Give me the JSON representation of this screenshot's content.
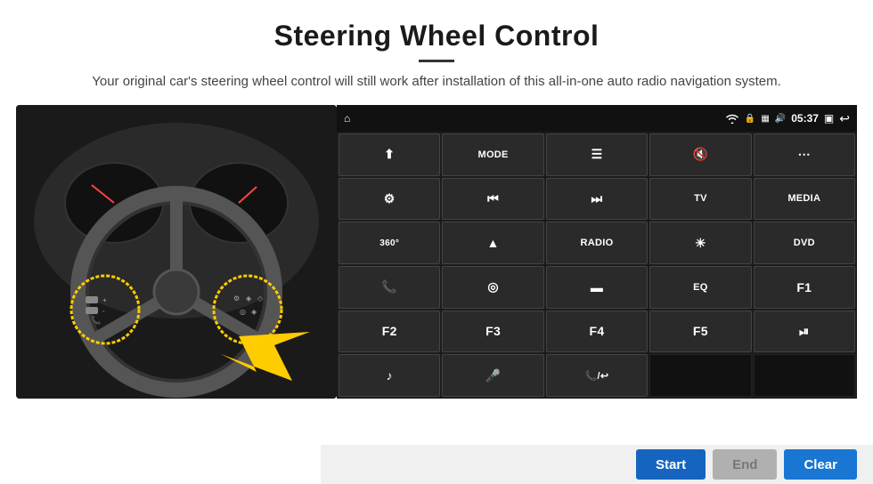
{
  "header": {
    "title": "Steering Wheel Control",
    "divider": true,
    "subtitle": "Your original car's steering wheel control will still work after installation of this all-in-one auto radio navigation system."
  },
  "status_bar": {
    "home_icon": "⌂",
    "wifi_icon": "wifi",
    "lock_icon": "🔒",
    "sd_icon": "SD",
    "bt_icon": "bt",
    "time": "05:37",
    "window_icon": "▣",
    "back_icon": "↩"
  },
  "grid_buttons": [
    {
      "id": "r1c1",
      "label": "⬆",
      "type": "icon"
    },
    {
      "id": "r1c2",
      "label": "MODE",
      "type": "text"
    },
    {
      "id": "r1c3",
      "label": "☰",
      "type": "icon"
    },
    {
      "id": "r1c4",
      "label": "🔇",
      "type": "icon"
    },
    {
      "id": "r1c5",
      "label": "⋯",
      "type": "icon"
    },
    {
      "id": "r2c1",
      "label": "⚙",
      "type": "icon"
    },
    {
      "id": "r2c2",
      "label": "⏮",
      "type": "icon"
    },
    {
      "id": "r2c3",
      "label": "⏭",
      "type": "icon"
    },
    {
      "id": "r2c4",
      "label": "TV",
      "type": "text"
    },
    {
      "id": "r2c5",
      "label": "MEDIA",
      "type": "text"
    },
    {
      "id": "r3c1",
      "label": "360",
      "type": "text"
    },
    {
      "id": "r3c2",
      "label": "▲",
      "type": "icon"
    },
    {
      "id": "r3c3",
      "label": "RADIO",
      "type": "text"
    },
    {
      "id": "r3c4",
      "label": "☀",
      "type": "icon"
    },
    {
      "id": "r3c5",
      "label": "DVD",
      "type": "text"
    },
    {
      "id": "r4c1",
      "label": "📞",
      "type": "icon"
    },
    {
      "id": "r4c2",
      "label": "◎",
      "type": "icon"
    },
    {
      "id": "r4c3",
      "label": "▬",
      "type": "icon"
    },
    {
      "id": "r4c4",
      "label": "EQ",
      "type": "text"
    },
    {
      "id": "r4c5",
      "label": "F1",
      "type": "text"
    },
    {
      "id": "r5c1",
      "label": "F2",
      "type": "text"
    },
    {
      "id": "r5c2",
      "label": "F3",
      "type": "text"
    },
    {
      "id": "r5c3",
      "label": "F4",
      "type": "text"
    },
    {
      "id": "r5c4",
      "label": "F5",
      "type": "text"
    },
    {
      "id": "r5c5",
      "label": "⏯",
      "type": "icon"
    },
    {
      "id": "r6c1",
      "label": "♪",
      "type": "icon"
    },
    {
      "id": "r6c2",
      "label": "🎤",
      "type": "icon"
    },
    {
      "id": "r6c3",
      "label": "📞",
      "type": "icon"
    },
    {
      "id": "r6c4",
      "label": "",
      "type": "empty"
    },
    {
      "id": "r6c5",
      "label": "",
      "type": "empty"
    }
  ],
  "bottom_bar": {
    "start_label": "Start",
    "end_label": "End",
    "clear_label": "Clear"
  }
}
